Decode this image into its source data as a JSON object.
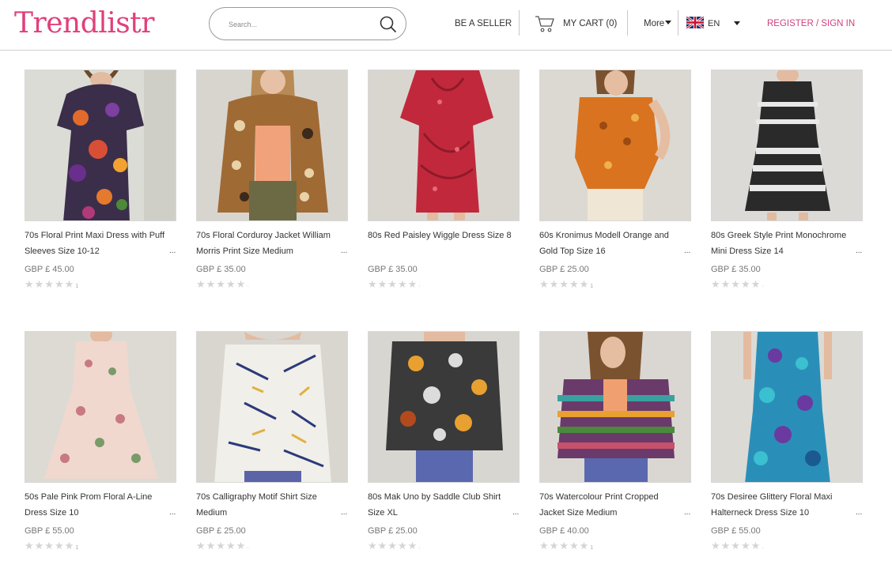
{
  "header": {
    "logo": "Trendlistr",
    "search_placeholder": "Search...",
    "be_a_seller": "BE A SELLER",
    "cart_label": "MY CART (0)",
    "more_label": "More",
    "language": "EN",
    "register_label": "REGISTER / SIGN IN"
  },
  "colors": {
    "brand": "#e0407a",
    "register_link": "#d1407f",
    "star_empty": "#d4d4d4"
  },
  "products": [
    {
      "title": "70s Floral Print Maxi Dress with Puff Sleeves Size 10-12",
      "price": "GBP £ 45.00",
      "ellipsis": "...",
      "rating_stars": "★★★★★",
      "rating_count": "1"
    },
    {
      "title": "70s Floral Corduroy Jacket William Morris Print Size Medium",
      "price": "GBP £ 35.00",
      "ellipsis": "...",
      "rating_stars": "★★★★★",
      "rating_count": "·"
    },
    {
      "title": "80s Red Paisley Wiggle Dress Size 8",
      "price": "GBP £ 35.00",
      "ellipsis": "",
      "rating_stars": "★★★★★",
      "rating_count": "·"
    },
    {
      "title": "60s Kronimus Modell Orange and Gold Top Size 16",
      "price": "GBP £ 25.00",
      "ellipsis": "...",
      "rating_stars": "★★★★★",
      "rating_count": "1"
    },
    {
      "title": "80s Greek Style Print Monochrome Mini Dress Size 14",
      "price": "GBP £ 35.00",
      "ellipsis": "...",
      "rating_stars": "★★★★★",
      "rating_count": "·"
    },
    {
      "title": "50s Pale Pink Prom Floral A-Line Dress Size 10",
      "price": "GBP £ 55.00",
      "ellipsis": "...",
      "rating_stars": "★★★★★",
      "rating_count": "1"
    },
    {
      "title": "70s Calligraphy Motif Shirt Size Medium",
      "price": "GBP £ 25.00",
      "ellipsis": "...",
      "rating_stars": "★★★★★",
      "rating_count": "·"
    },
    {
      "title": "80s Mak Uno by Saddle Club Shirt Size XL",
      "price": "GBP £ 25.00",
      "ellipsis": "...",
      "rating_stars": "★★★★★",
      "rating_count": "·"
    },
    {
      "title": "70s Watercolour Print Cropped Jacket Size Medium",
      "price": "GBP £ 40.00",
      "ellipsis": "...",
      "rating_stars": "★★★★★",
      "rating_count": "1"
    },
    {
      "title": "70s Desiree Glittery Floral Maxi Halterneck Dress Size 10",
      "price": "GBP £ 55.00",
      "ellipsis": "...",
      "rating_stars": "★★★★★",
      "rating_count": "·"
    }
  ]
}
